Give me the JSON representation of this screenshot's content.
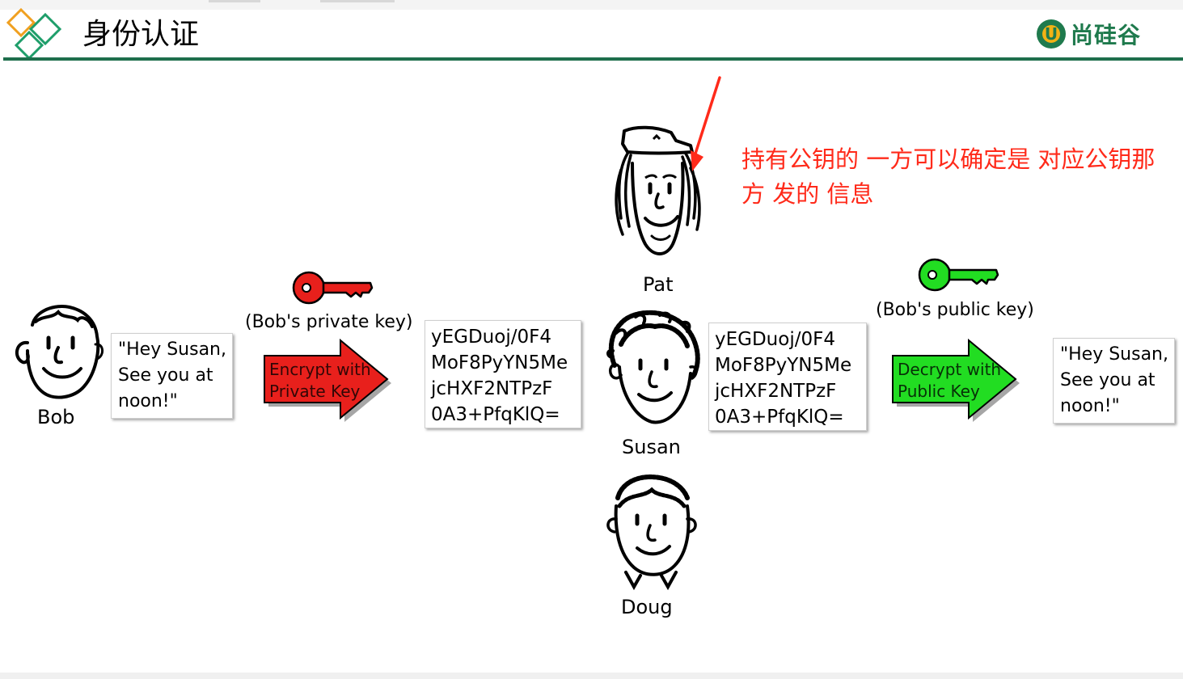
{
  "header": {
    "title": "身份认证",
    "brand_name": "尚硅谷",
    "brand_mark": "U",
    "accent_color": "#1e6e4c",
    "brand_color": "#1f7a4d"
  },
  "people": {
    "bob": "Bob",
    "pat": "Pat",
    "susan": "Susan",
    "doug": "Doug"
  },
  "messages": {
    "plain_left": "\"Hey Susan,\nSee you at\nnoon!\"",
    "plain_right": "\"Hey Susan,\nSee you at\nnoon!\""
  },
  "ciphertext": {
    "left": [
      "yEGDuoj/0F4",
      "MoF8PyYN5Me",
      "jcHXF2NTPzF",
      "0A3+PfqKlQ="
    ],
    "right": [
      "yEGDuoj/0F4",
      "MoF8PyYN5Me",
      "jcHXF2NTPzF",
      "0A3+PfqKlQ="
    ]
  },
  "keys": {
    "private_label": "(Bob's private key)",
    "public_label": "(Bob's public key)",
    "private_color": "#e8201c",
    "public_color": "#22dd22"
  },
  "arrows": {
    "encrypt_label": "Encrypt with\nPrivate Key",
    "decrypt_label": "Decrypt with\nPublic Key",
    "encrypt_color": "#e8201c",
    "decrypt_color": "#22dd22"
  },
  "annotation": {
    "text": "持有公钥的 一方可以确定是 对应公钥那方 发的 信息",
    "color": "#ff2a1a"
  }
}
